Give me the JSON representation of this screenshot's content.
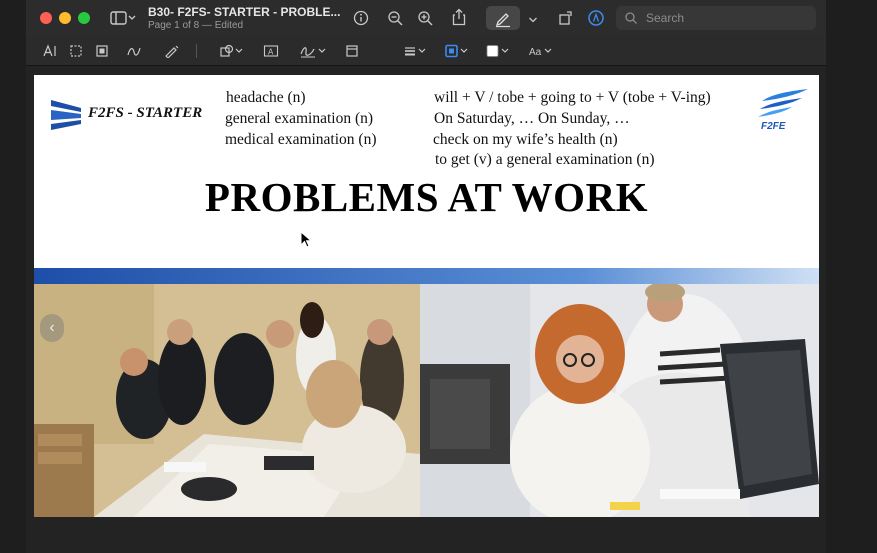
{
  "window": {
    "doc_title": "B30- F2FS- STARTER - PROBLE...",
    "doc_subtitle": "Page 1 of 8 — Edited",
    "search_placeholder": "Search"
  },
  "slide": {
    "brand_text": "F2FS - STARTER",
    "logo_right_text": "F2FE",
    "vocab_left": [
      "headache (n)",
      "general examination (n)",
      "medical examination (n)"
    ],
    "vocab_right": [
      "will + V / tobe + going to + V (tobe + V-ing)",
      "On Saturday, … On Sunday, …",
      "check on my wife’s health (n)",
      "to get (v) a general examination (n)"
    ],
    "title": "PROBLEMS AT WORK"
  },
  "colors": {
    "accent_blue": "#1d4fa8",
    "window_bg": "#2c2c2c"
  }
}
